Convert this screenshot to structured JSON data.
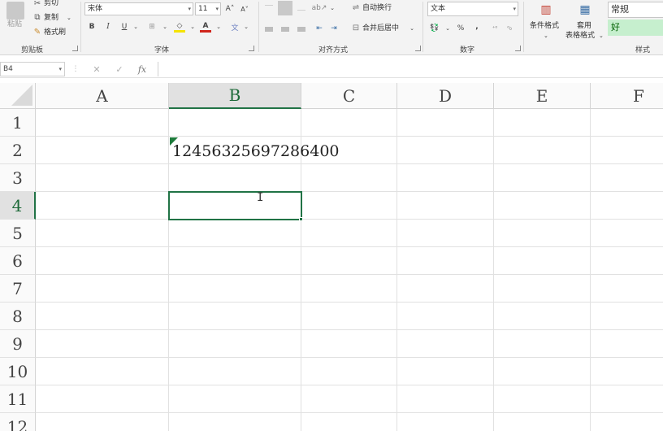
{
  "ribbon": {
    "clipboard": {
      "paste": "粘贴",
      "cut": "剪切",
      "copy": "复制",
      "format_painter": "格式刷",
      "group": "剪贴板"
    },
    "font": {
      "font_name": "宋体",
      "font_size": "11",
      "bold": "B",
      "italic": "I",
      "underline": "U",
      "group": "字体"
    },
    "alignment": {
      "wrap_text": "自动换行",
      "merge_center": "合并后居中",
      "group": "对齐方式"
    },
    "number": {
      "format": "文本",
      "percent": "%",
      "comma": ",",
      "group": "数字"
    },
    "styles": {
      "conditional_format": "条件格式",
      "table_format_line1": "套用",
      "table_format_line2": "表格格式",
      "style_normal": "常规",
      "style_good": "好",
      "group": "样式"
    }
  },
  "formula_bar": {
    "name_box": "B4",
    "fx": "fx",
    "value": ""
  },
  "sheet": {
    "columns": [
      "A",
      "B",
      "C",
      "D",
      "E",
      "F"
    ],
    "rows": [
      "1",
      "2",
      "3",
      "4",
      "5",
      "6",
      "7",
      "8",
      "9",
      "10",
      "11",
      "12"
    ],
    "active_column": "B",
    "active_row": "4",
    "cells": {
      "B2": "12456325697286400"
    }
  },
  "colors": {
    "accent": "#217346",
    "good_fill": "#c6efce",
    "good_text": "#006100"
  }
}
